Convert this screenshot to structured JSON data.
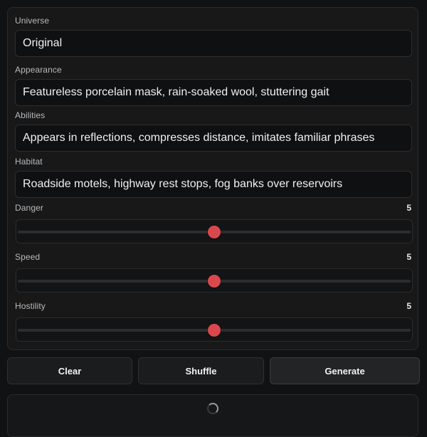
{
  "form": {
    "universe": {
      "label": "Universe",
      "value": "Original"
    },
    "appearance": {
      "label": "Appearance",
      "value": "Featureless porcelain mask, rain-soaked wool, stuttering gait"
    },
    "abilities": {
      "label": "Abilities",
      "value": "Appears in reflections, compresses distance, imitates familiar phrases"
    },
    "habitat": {
      "label": "Habitat",
      "value": "Roadside motels, highway rest stops, fog banks over reservoirs"
    },
    "danger": {
      "label": "Danger",
      "value": "5",
      "level": 5,
      "min": 0,
      "max": 10
    },
    "speed": {
      "label": "Speed",
      "value": "5",
      "level": 5,
      "min": 0,
      "max": 10
    },
    "hostility": {
      "label": "Hostility",
      "value": "5",
      "level": 5,
      "min": 0,
      "max": 10
    }
  },
  "actions": {
    "clear_label": "Clear",
    "shuffle_label": "Shuffle",
    "generate_label": "Generate"
  },
  "output": {
    "status_icon": "loading-spinner-icon"
  },
  "colors": {
    "accent": "#d9484d",
    "background": "#111213",
    "panel": "#181819"
  }
}
